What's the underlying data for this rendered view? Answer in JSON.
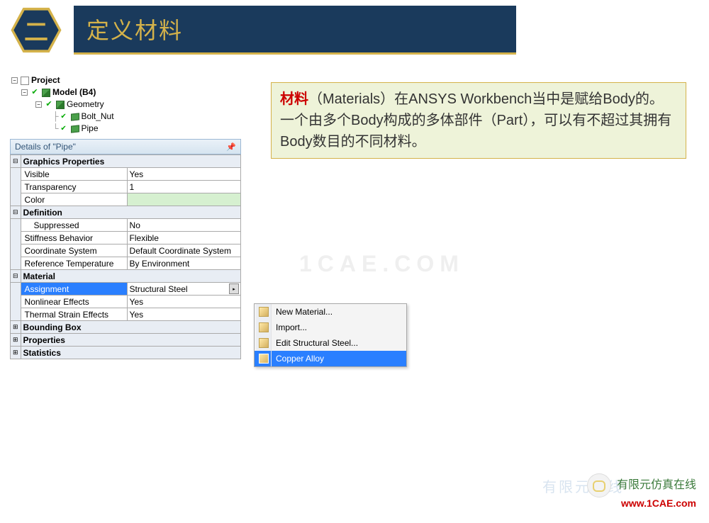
{
  "header": {
    "badge": "二",
    "title": "定义材料"
  },
  "tree": {
    "project": "Project",
    "model": "Model (B4)",
    "geometry": "Geometry",
    "bodies": [
      "Bolt_Nut",
      "Pipe"
    ]
  },
  "details_title": "Details of \"Pipe\"",
  "props": {
    "graphics": {
      "cat": "Graphics Properties",
      "visible_k": "Visible",
      "visible_v": "Yes",
      "transparency_k": "Transparency",
      "transparency_v": "1",
      "color_k": "Color",
      "color_v": ""
    },
    "definition": {
      "cat": "Definition",
      "suppressed_k": "Suppressed",
      "suppressed_v": "No",
      "stiffness_k": "Stiffness Behavior",
      "stiffness_v": "Flexible",
      "csys_k": "Coordinate System",
      "csys_v": "Default Coordinate System",
      "reftemp_k": "Reference Temperature",
      "reftemp_v": "By Environment"
    },
    "material": {
      "cat": "Material",
      "assign_k": "Assignment",
      "assign_v": "Structural Steel",
      "nonlin_k": "Nonlinear Effects",
      "nonlin_v": "Yes",
      "thermal_k": "Thermal Strain Effects",
      "thermal_v": "Yes"
    },
    "bbox_cat": "Bounding Box",
    "props_cat": "Properties",
    "stats_cat": "Statistics"
  },
  "ctx": {
    "new_mat": "New Material...",
    "import": "Import...",
    "edit": "Edit Structural Steel...",
    "copper": "Copper Alloy"
  },
  "info": {
    "red": "材料",
    "p1a": "（Materials）在ANSYS Workbench当中是赋给Body的。一个由多个Body构成的多体部件（Part），可以有不超过其拥有Body数目的不同材料。"
  },
  "watermark": "1CAE.COM",
  "brand": {
    "text": "有限元仿真在线",
    "url": "www.1CAE.com",
    "faint": "有限元在线"
  }
}
